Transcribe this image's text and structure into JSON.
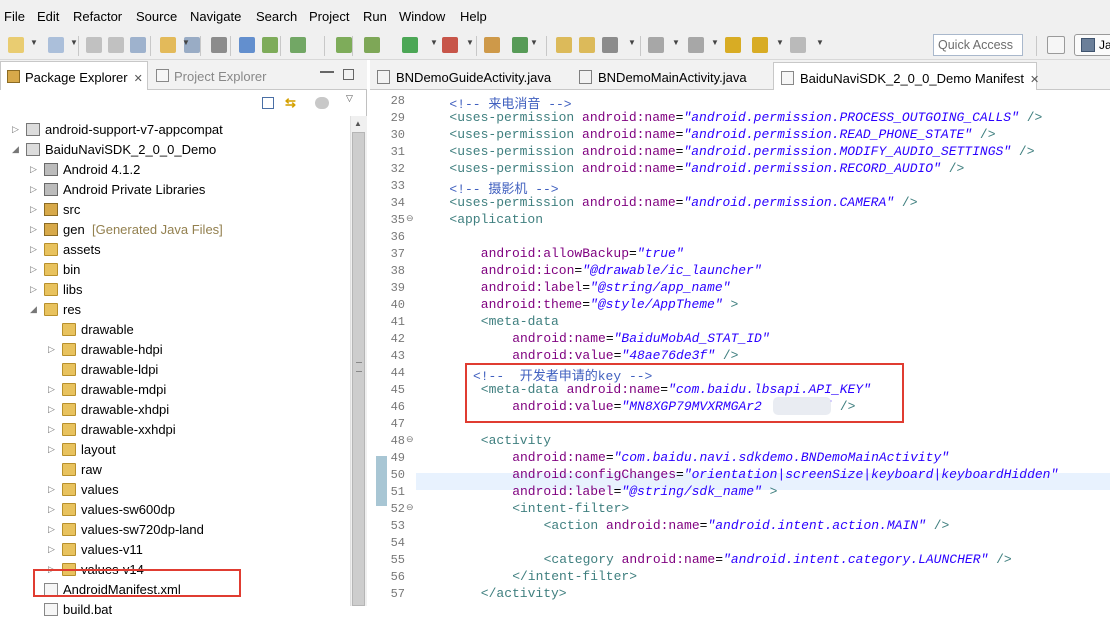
{
  "menu": [
    "File",
    "Edit",
    "Refactor",
    "Source",
    "Navigate",
    "Search",
    "Project",
    "Run",
    "Window",
    "Help"
  ],
  "toolbar": {
    "quick_access_placeholder": "Quick Access",
    "perspective_label": "Ja"
  },
  "left_panel": {
    "tabs": [
      {
        "label": "Package Explorer",
        "active": true
      },
      {
        "label": "Project Explorer",
        "active": false
      }
    ],
    "tree": [
      {
        "label": "android-support-v7-appcompat",
        "icon": "project-icon",
        "expanded": false
      },
      {
        "label": "BaiduNaviSDK_2_0_0_Demo",
        "icon": "project-icon",
        "expanded": true
      },
      {
        "label": "Android 4.1.2",
        "icon": "library-icon",
        "expanded": false
      },
      {
        "label": "Android Private Libraries",
        "icon": "library-icon",
        "expanded": false
      },
      {
        "label": "src",
        "icon": "package-folder-icon",
        "expanded": false
      },
      {
        "label": "gen",
        "suffix": "[Generated Java Files]",
        "icon": "package-folder-icon",
        "expanded": false
      },
      {
        "label": "assets",
        "icon": "folder-icon",
        "expanded": false
      },
      {
        "label": "bin",
        "icon": "folder-icon",
        "expanded": false
      },
      {
        "label": "libs",
        "icon": "folder-icon",
        "expanded": false
      },
      {
        "label": "res",
        "icon": "folder-icon",
        "expanded": true
      },
      {
        "label": "drawable",
        "icon": "folder-icon",
        "expanded": null
      },
      {
        "label": "drawable-hdpi",
        "icon": "folder-icon",
        "expanded": false
      },
      {
        "label": "drawable-ldpi",
        "icon": "folder-icon",
        "expanded": null
      },
      {
        "label": "drawable-mdpi",
        "icon": "folder-icon",
        "expanded": false
      },
      {
        "label": "drawable-xhdpi",
        "icon": "folder-icon",
        "expanded": false
      },
      {
        "label": "drawable-xxhdpi",
        "icon": "folder-icon",
        "expanded": false
      },
      {
        "label": "layout",
        "icon": "folder-icon",
        "expanded": false
      },
      {
        "label": "raw",
        "icon": "folder-icon",
        "expanded": null
      },
      {
        "label": "values",
        "icon": "folder-icon",
        "expanded": false
      },
      {
        "label": "values-sw600dp",
        "icon": "folder-icon",
        "expanded": false
      },
      {
        "label": "values-sw720dp-land",
        "icon": "folder-icon",
        "expanded": false
      },
      {
        "label": "values-v11",
        "icon": "folder-icon",
        "expanded": false
      },
      {
        "label": "values-v14",
        "icon": "folder-icon",
        "expanded": false
      },
      {
        "label": "AndroidManifest.xml",
        "icon": "xml-file-icon",
        "expanded": null,
        "highlighted": true
      },
      {
        "label": "build.bat",
        "icon": "file-icon",
        "expanded": null
      }
    ]
  },
  "editor": {
    "tabs": [
      {
        "label": "BNDemoGuideActivity.java",
        "active": false
      },
      {
        "label": "BNDemoMainActivity.java",
        "active": false
      },
      {
        "label": "BaiduNaviSDK_2_0_0_Demo Manifest",
        "active": true
      }
    ],
    "lines": [
      {
        "n": "28",
        "fold": "",
        "segs": [
          [
            "cm",
            "<!-- 来电消音 -->"
          ]
        ],
        "indent": 4
      },
      {
        "n": "29",
        "fold": "",
        "segs": [
          [
            "tg",
            "<uses-permission "
          ],
          [
            "at",
            "android:name"
          ],
          [
            "eq",
            "="
          ],
          [
            "st",
            "\"android.permission.PROCESS_OUTGOING_CALLS\""
          ],
          [
            "tg",
            " />"
          ]
        ],
        "indent": 4
      },
      {
        "n": "30",
        "fold": "",
        "segs": [
          [
            "tg",
            "<uses-permission "
          ],
          [
            "at",
            "android:name"
          ],
          [
            "eq",
            "="
          ],
          [
            "st",
            "\"android.permission.READ_PHONE_STATE\""
          ],
          [
            "tg",
            " />"
          ]
        ],
        "indent": 4
      },
      {
        "n": "31",
        "fold": "",
        "segs": [
          [
            "tg",
            "<uses-permission "
          ],
          [
            "at",
            "android:name"
          ],
          [
            "eq",
            "="
          ],
          [
            "st",
            "\"android.permission.MODIFY_AUDIO_SETTINGS\""
          ],
          [
            "tg",
            " />"
          ]
        ],
        "indent": 4
      },
      {
        "n": "32",
        "fold": "",
        "segs": [
          [
            "tg",
            "<uses-permission "
          ],
          [
            "at",
            "android:name"
          ],
          [
            "eq",
            "="
          ],
          [
            "st",
            "\"android.permission.RECORD_AUDIO\""
          ],
          [
            "tg",
            " />"
          ]
        ],
        "indent": 4
      },
      {
        "n": "33",
        "fold": "",
        "segs": [
          [
            "cm",
            "<!-- 摄影机 -->"
          ]
        ],
        "indent": 4
      },
      {
        "n": "34",
        "fold": "",
        "segs": [
          [
            "tg",
            "<uses-permission "
          ],
          [
            "at",
            "android:name"
          ],
          [
            "eq",
            "="
          ],
          [
            "st",
            "\"android.permission.CAMERA\""
          ],
          [
            "tg",
            " />"
          ]
        ],
        "indent": 4
      },
      {
        "n": "35",
        "fold": "⊖",
        "segs": [
          [
            "tg",
            "<application"
          ]
        ],
        "indent": 4
      },
      {
        "n": "36",
        "fold": "",
        "segs": [],
        "indent": 0
      },
      {
        "n": "37",
        "fold": "",
        "segs": [
          [
            "at",
            "android:allowBackup"
          ],
          [
            "eq",
            "="
          ],
          [
            "st",
            "\"true\""
          ]
        ],
        "indent": 8
      },
      {
        "n": "38",
        "fold": "",
        "segs": [
          [
            "at",
            "android:icon"
          ],
          [
            "eq",
            "="
          ],
          [
            "st",
            "\"@drawable/ic_launcher\""
          ]
        ],
        "indent": 8
      },
      {
        "n": "39",
        "fold": "",
        "segs": [
          [
            "at",
            "android:label"
          ],
          [
            "eq",
            "="
          ],
          [
            "st",
            "\"@string/app_name\""
          ]
        ],
        "indent": 8
      },
      {
        "n": "40",
        "fold": "",
        "segs": [
          [
            "at",
            "android:theme"
          ],
          [
            "eq",
            "="
          ],
          [
            "st",
            "\"@style/AppTheme\""
          ],
          [
            "tg",
            " >"
          ]
        ],
        "indent": 8
      },
      {
        "n": "41",
        "fold": "",
        "segs": [
          [
            "tg",
            "<meta-data"
          ]
        ],
        "indent": 8
      },
      {
        "n": "42",
        "fold": "",
        "segs": [
          [
            "at",
            "android:name"
          ],
          [
            "eq",
            "="
          ],
          [
            "st",
            "\"BaiduMobAd_STAT_ID\""
          ]
        ],
        "indent": 12
      },
      {
        "n": "43",
        "fold": "",
        "segs": [
          [
            "at",
            "android:value"
          ],
          [
            "eq",
            "="
          ],
          [
            "st",
            "\"48ae76de3f\""
          ],
          [
            "tg",
            " />"
          ]
        ],
        "indent": 12
      },
      {
        "n": "44",
        "fold": "",
        "segs": [
          [
            "cm",
            "<!--  开发者申请的key -->"
          ]
        ],
        "indent": 7
      },
      {
        "n": "45",
        "fold": "",
        "segs": [
          [
            "tg",
            "<meta-data "
          ],
          [
            "at",
            "android:name"
          ],
          [
            "eq",
            "="
          ],
          [
            "st",
            "\"com.baidu.lbsapi.API_KEY\""
          ]
        ],
        "indent": 8
      },
      {
        "n": "46",
        "fold": "",
        "segs": [
          [
            "at",
            "android:value"
          ],
          [
            "eq",
            "="
          ],
          [
            "st",
            "\"MN8XGP79MVXRMGAr2        \""
          ],
          [
            "tg",
            " />"
          ]
        ],
        "indent": 12
      },
      {
        "n": "47",
        "fold": "",
        "segs": [],
        "indent": 0
      },
      {
        "n": "48",
        "fold": "⊖",
        "segs": [
          [
            "tg",
            "<activity"
          ]
        ],
        "indent": 8
      },
      {
        "n": "49",
        "fold": "",
        "segs": [
          [
            "at",
            "android:name"
          ],
          [
            "eq",
            "="
          ],
          [
            "st",
            "\"com.baidu.navi.sdkdemo.BNDemoMainActivity\""
          ]
        ],
        "indent": 12
      },
      {
        "n": "50",
        "fold": "",
        "segs": [
          [
            "at",
            "android:configChanges"
          ],
          [
            "eq",
            "="
          ],
          [
            "st",
            "\"orientation|screenSize|keyboard|keyboardHidden\""
          ]
        ],
        "indent": 12
      },
      {
        "n": "51",
        "fold": "",
        "segs": [
          [
            "at",
            "android:label"
          ],
          [
            "eq",
            "="
          ],
          [
            "st",
            "\"@string/sdk_name\""
          ],
          [
            "tg",
            " >"
          ]
        ],
        "indent": 12
      },
      {
        "n": "52",
        "fold": "⊖",
        "segs": [
          [
            "tg",
            "<intent-filter>"
          ]
        ],
        "indent": 12
      },
      {
        "n": "53",
        "fold": "",
        "segs": [
          [
            "tg",
            "<action "
          ],
          [
            "at",
            "android:name"
          ],
          [
            "eq",
            "="
          ],
          [
            "st",
            "\"android.intent.action.MAIN\""
          ],
          [
            "tg",
            " />"
          ]
        ],
        "indent": 16
      },
      {
        "n": "54",
        "fold": "",
        "segs": [],
        "indent": 0
      },
      {
        "n": "55",
        "fold": "",
        "segs": [
          [
            "tg",
            "<category "
          ],
          [
            "at",
            "android:name"
          ],
          [
            "eq",
            "="
          ],
          [
            "st",
            "\"android.intent.category.LAUNCHER\""
          ],
          [
            "tg",
            " />"
          ]
        ],
        "indent": 16
      },
      {
        "n": "56",
        "fold": "",
        "segs": [
          [
            "tg",
            "</intent-filter>"
          ]
        ],
        "indent": 12
      },
      {
        "n": "57",
        "fold": "",
        "segs": [
          [
            "tg",
            "</activity>"
          ]
        ],
        "indent": 8
      }
    ]
  },
  "colors": {
    "highlight_box": "#e03c31",
    "comment": "#3f5fbf",
    "tag": "#3f7f7f",
    "attribute": "#7f007f",
    "string": "#2a00ff"
  }
}
